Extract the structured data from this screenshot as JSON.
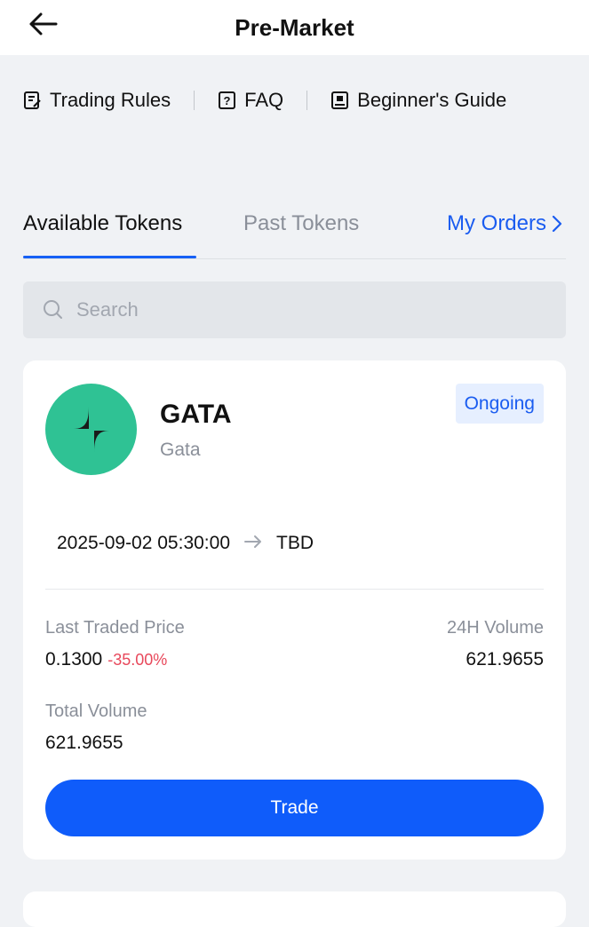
{
  "header": {
    "title": "Pre-Market"
  },
  "links": [
    {
      "label": "Trading Rules",
      "icon": "rules-icon"
    },
    {
      "label": "FAQ",
      "icon": "faq-icon"
    },
    {
      "label": "Beginner's Guide",
      "icon": "guide-icon"
    }
  ],
  "tabs": {
    "available": "Available Tokens",
    "past": "Past Tokens",
    "orders": "My Orders"
  },
  "search": {
    "placeholder": "Search"
  },
  "token": {
    "symbol": "GATA",
    "name": "Gata",
    "status": "Ongoing",
    "start": "2025-09-02 05:30:00",
    "end": "TBD",
    "last_price_label": "Last Traded Price",
    "last_price": "0.1300",
    "change": "-35.00%",
    "volume_24h_label": "24H Volume",
    "volume_24h": "621.9655",
    "total_volume_label": "Total Volume",
    "total_volume": "621.9655",
    "trade_label": "Trade"
  },
  "colors": {
    "accent": "#0f5cfa",
    "logo_bg": "#2fc294",
    "negative": "#e8485b",
    "badge_bg": "#e6efff"
  }
}
